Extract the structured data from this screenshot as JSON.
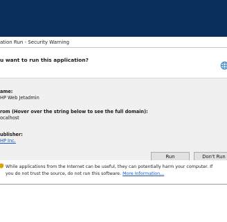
{
  "dialog": {
    "caption": "ation Run - Security Warning",
    "question": "u want to run this application?",
    "globe_icon": "globe-icon"
  },
  "details": {
    "name_label": "ame:",
    "name_value": "HP Web Jetadmin",
    "from_label": "rom (Hover over the string below to see the full domain):",
    "from_value": "ocalhost",
    "publisher_label": "ublisher:",
    "publisher_value": "HP Inc."
  },
  "buttons": {
    "run": "Run",
    "dont_run": "Don't Run"
  },
  "warning": {
    "line1": "While applications from the Internet can be useful, they can potentially harm your computer. If",
    "line2": "you do not trust the source, do not run this software.",
    "more_info": "More Information...",
    "icon": "shield-warning-icon"
  },
  "colors": {
    "titlebar": "#0b2f5b",
    "details_bg": "#f0f0f0",
    "link": "#1a55c4"
  }
}
